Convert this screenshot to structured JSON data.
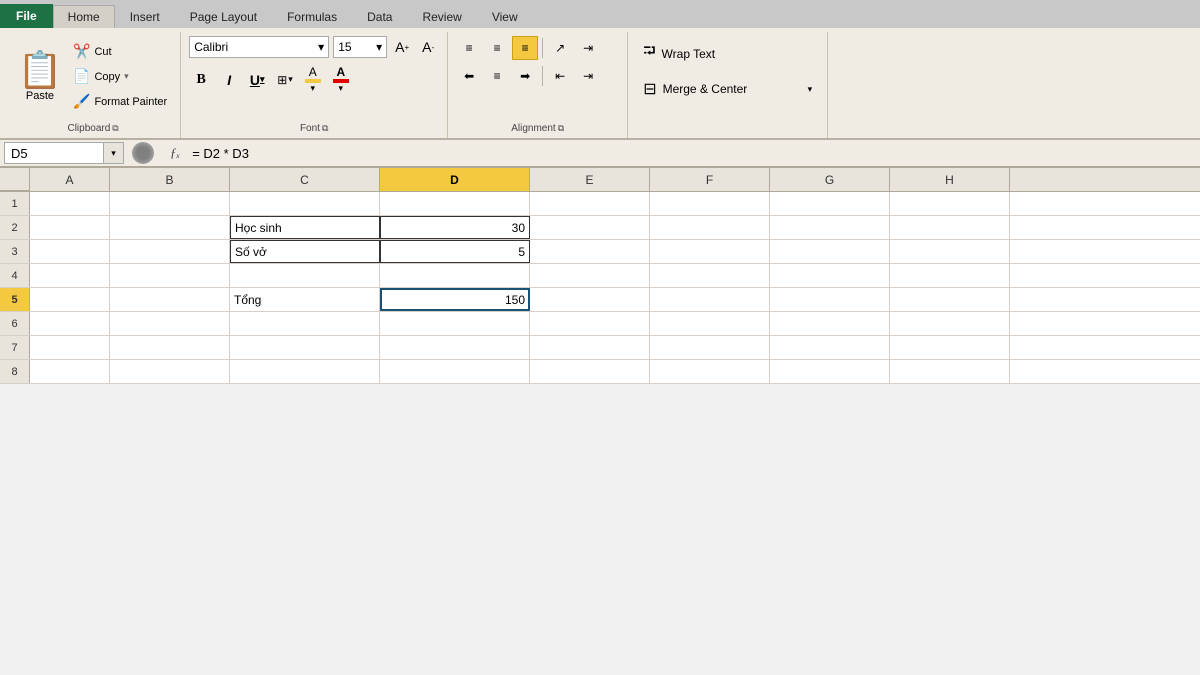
{
  "tabs": {
    "file": "File",
    "home": "Home",
    "insert": "Insert",
    "page_layout": "Page Layout",
    "formulas": "Formulas",
    "data": "Data",
    "review": "Review",
    "view": "View"
  },
  "clipboard": {
    "paste_label": "Paste",
    "cut_label": "Cut",
    "copy_label": "Copy",
    "format_painter_label": "Format Painter",
    "group_label": "Clipboard"
  },
  "font": {
    "font_name": "Calibri",
    "font_size": "15",
    "bold_label": "B",
    "italic_label": "I",
    "underline_label": "U",
    "group_label": "Font"
  },
  "alignment": {
    "group_label": "Alignment",
    "wrap_text_label": "Wrap Text",
    "merge_center_label": "Merge & Center"
  },
  "formula_bar": {
    "cell_ref": "D5",
    "formula": "= D2 * D3"
  },
  "columns": [
    "A",
    "B",
    "C",
    "D",
    "E",
    "F",
    "G",
    "H"
  ],
  "rows": [
    {
      "num": "1",
      "cells": [
        "",
        "",
        "",
        "",
        "",
        "",
        "",
        ""
      ]
    },
    {
      "num": "2",
      "cells": [
        "",
        "",
        "Học sinh",
        "30",
        "",
        "",
        "",
        ""
      ]
    },
    {
      "num": "3",
      "cells": [
        "",
        "",
        "Số vở",
        "5",
        "",
        "",
        "",
        ""
      ]
    },
    {
      "num": "4",
      "cells": [
        "",
        "",
        "",
        "",
        "",
        "",
        "",
        ""
      ]
    },
    {
      "num": "5",
      "cells": [
        "",
        "",
        "Tổng",
        "150",
        "",
        "",
        "",
        ""
      ]
    },
    {
      "num": "6",
      "cells": [
        "",
        "",
        "",
        "",
        "",
        "",
        "",
        ""
      ]
    },
    {
      "num": "7",
      "cells": [
        "",
        "",
        "",
        "",
        "",
        "",
        "",
        ""
      ]
    },
    {
      "num": "8",
      "cells": [
        "",
        "",
        "",
        "",
        "",
        "",
        "",
        ""
      ]
    }
  ]
}
